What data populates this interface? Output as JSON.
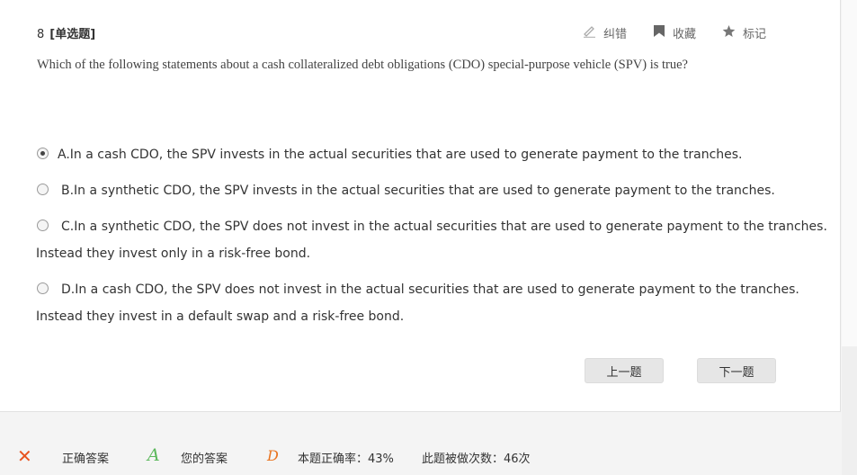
{
  "question": {
    "number": "8",
    "type_label": "[单选题]",
    "text": "Which of the following statements about a cash collateralized debt obligations (CDO) special-purpose vehicle (SPV) is true?"
  },
  "tools": {
    "correct_error": "纠错",
    "favorite": "收藏",
    "mark": "标记"
  },
  "options": [
    {
      "line1": "A.In a cash CDO, the SPV invests in the actual securities that are used to generate payment to the tranches.",
      "line2": "",
      "selected": true
    },
    {
      "line1": "B.In a synthetic CDO, the SPV invests in the actual securities that are used to generate payment to the tranches.",
      "line2": "",
      "selected": false
    },
    {
      "line1": "C.In a synthetic CDO, the SPV does not invest in the actual securities that are used to generate payment to the tranches.",
      "line2": "Instead they invest only in a risk-free bond.",
      "selected": false
    },
    {
      "line1": "D.In a cash CDO, the SPV does not invest in the actual securities that are used to generate payment to the tranches.",
      "line2": "Instead they invest in a default swap and a risk-free bond.",
      "selected": false
    }
  ],
  "nav": {
    "prev": "上一题",
    "next": "下一题"
  },
  "footer": {
    "correct_mark": "✕",
    "correct_label": "正确答案",
    "your_answer_value": "A",
    "your_answer_label": "您的答案",
    "rate_value": "D",
    "rate_text": "本题正确率：43%",
    "attempts_text": "此题被做次数：46次"
  },
  "colors": {
    "accent_orange": "#e8531f",
    "answer_green": "#5cb85c"
  }
}
